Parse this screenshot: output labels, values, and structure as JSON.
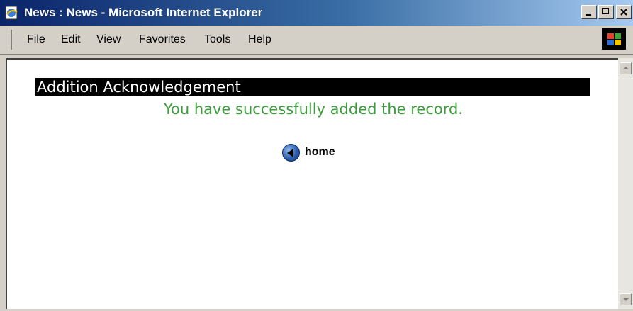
{
  "window": {
    "title": "News : News - Microsoft Internet Explorer"
  },
  "menu": {
    "items": [
      "File",
      "Edit",
      "View",
      "Favorites",
      "Tools",
      "Help"
    ]
  },
  "page": {
    "heading": "Addition Acknowledgement",
    "message": "You have successfully added the record.",
    "home_link": "home"
  },
  "colors": {
    "title_bar": "#0a246a",
    "heading_bg": "#000000",
    "heading_text": "#ffffff",
    "message_text": "#3b9c3b"
  },
  "icons": {
    "back_arrow": "back-arrow-icon",
    "window_app": "ie-page-icon",
    "brand": "windows-flag-logo"
  }
}
